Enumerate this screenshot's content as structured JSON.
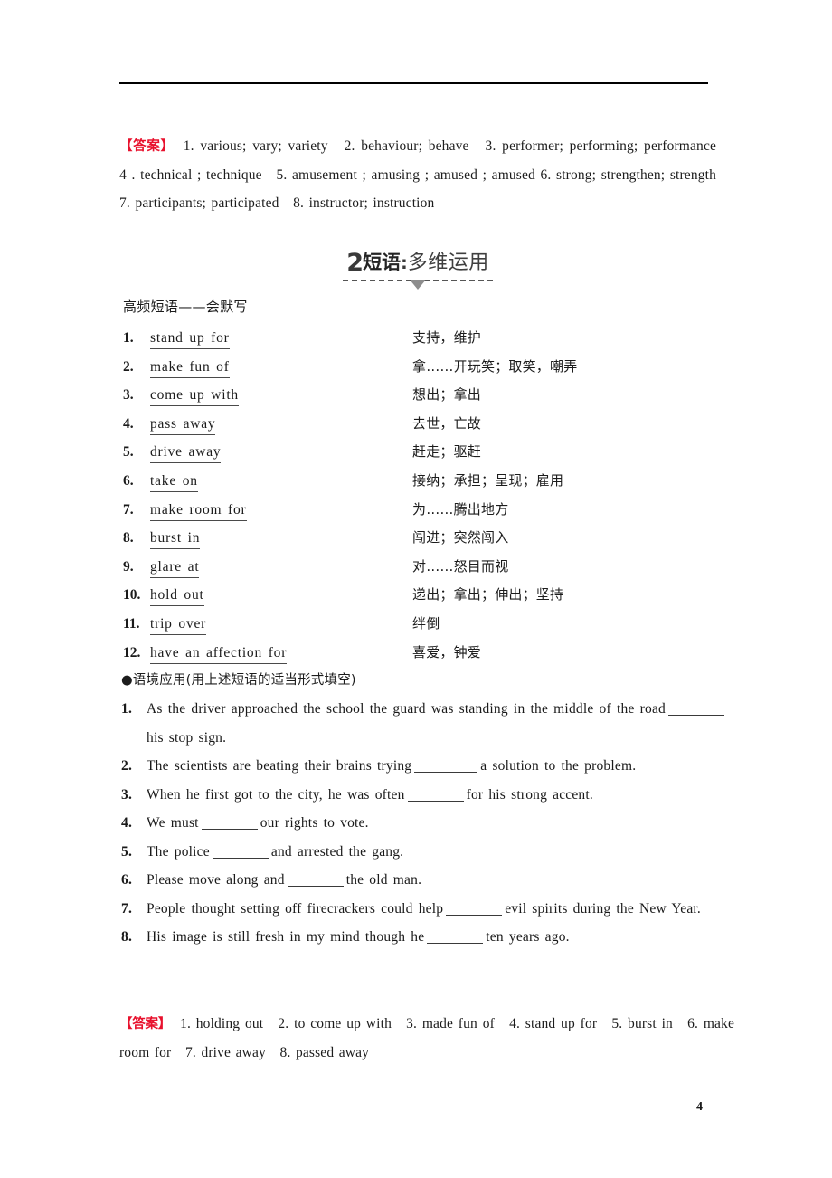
{
  "page": {
    "number": "4"
  },
  "answer_top": {
    "label": "【答案】",
    "body": "1. various; vary; variety　2. behaviour; behave　3. performer; performing; performance　4 . technical ; technique　5. amusement ; amusing ; amused ; amused 6. strong; strengthen; strength　7. participants; participated　8. instructor; instruction"
  },
  "section_heading": {
    "number": "2",
    "keyword": "短语",
    "colon": ":",
    "subtitle": "多维运用"
  },
  "phrase_section": {
    "subtitle": "高频短语——会默写",
    "items": [
      {
        "num": "1.",
        "en": "stand up for",
        "cn": "支持，维护"
      },
      {
        "num": "2.",
        "en": "make fun of",
        "cn": "拿……开玩笑；取笑，嘲弄"
      },
      {
        "num": "3.",
        "en": "come up  with",
        "cn": "想出；拿出"
      },
      {
        "num": "4.",
        "en": "pass away",
        "cn": "去世，亡故"
      },
      {
        "num": "5.",
        "en": "drive away",
        "cn": "赶走；驱赶"
      },
      {
        "num": "6.",
        "en": "take on",
        "cn": "接纳；承担；呈现；雇用"
      },
      {
        "num": "7.",
        "en": "make room for",
        "cn": "为……腾出地方"
      },
      {
        "num": "8.",
        "en": "burst in",
        "cn": "闯进；突然闯入"
      },
      {
        "num": "9.",
        "en": "glare at",
        "cn": "对……怒目而视"
      },
      {
        "num": "10.",
        "en": "hold out",
        "cn": "递出；拿出；伸出；坚持"
      },
      {
        "num": "11.",
        "en": "trip  over",
        "cn": "绊倒"
      },
      {
        "num": "12.",
        "en": "have an affection for",
        "cn": "喜爱，钟爱"
      }
    ]
  },
  "context_section": {
    "title": "●语境应用(用上述短语的适当形式填空)",
    "exercises": [
      {
        "num": "1.",
        "before": "As the driver approached the school the guard was standing in the middle of the road",
        "after": "his stop sign."
      },
      {
        "num": "2.",
        "before": "The scientists are beating their brains trying",
        "after": "a solution to the problem."
      },
      {
        "num": "3.",
        "before": "When he first got to the city, he was often",
        "after": "for his strong accent."
      },
      {
        "num": "4.",
        "before": "We must",
        "after": "our rights to vote."
      },
      {
        "num": "5.",
        "before": "The police",
        "after": "and arrested the gang."
      },
      {
        "num": "6.",
        "before": "Please move along and",
        "after": "the old man."
      },
      {
        "num": "7.",
        "before": "People thought setting off firecrackers could help",
        "after": "evil spirits during the New Year."
      },
      {
        "num": "8.",
        "before": "His image is still fresh in my mind though he",
        "after": "ten years ago."
      }
    ]
  },
  "answer_bottom": {
    "label": "【答案】",
    "body": "1. holding out　2. to come up with　3. made fun of　4. stand up for　5. burst in　6. make room for　7. drive away　8. passed away"
  },
  "colors": {
    "answer_label": "#e8112d",
    "text": "#1a1a1a",
    "rule": "#000000"
  }
}
